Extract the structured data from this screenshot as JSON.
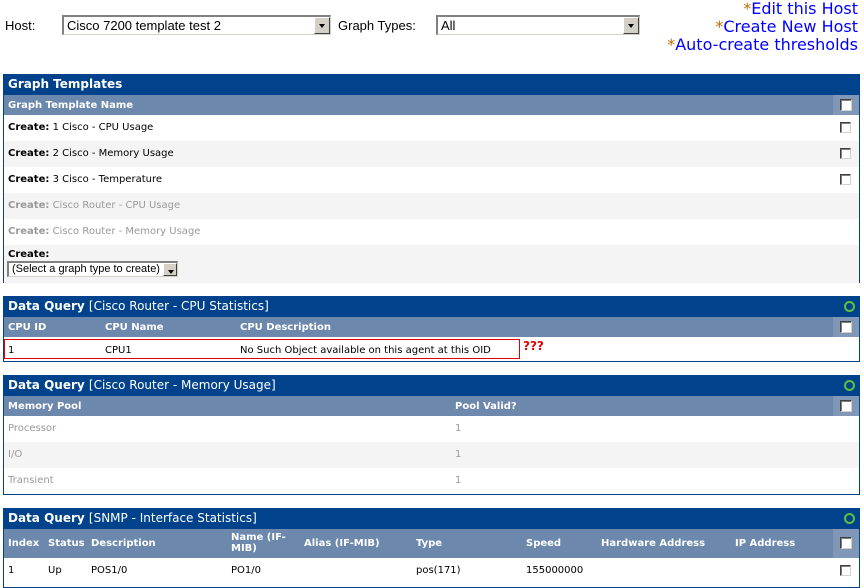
{
  "filters": {
    "host_label": "Host:",
    "host_value": "Cisco 7200 template test 2",
    "graph_types_label": "Graph Types:",
    "graph_types_value": "All"
  },
  "links": [
    {
      "star": "*",
      "label": "Edit this Host"
    },
    {
      "star": "*",
      "label": "Create New Host"
    },
    {
      "star": "*",
      "label": "Auto-create thresholds"
    }
  ],
  "graph_templates": {
    "title": "Graph Templates",
    "column_header": "Graph Template Name",
    "rows": [
      {
        "prefix": "Create:",
        "name": "1 Cisco - CPU Usage",
        "enabled": true
      },
      {
        "prefix": "Create:",
        "name": "2 Cisco - Memory Usage",
        "enabled": true
      },
      {
        "prefix": "Create:",
        "name": "3 Cisco - Temperature",
        "enabled": true
      },
      {
        "prefix": "Create:",
        "name": "Cisco Router - CPU Usage",
        "enabled": false
      },
      {
        "prefix": "Create:",
        "name": "Cisco Router - Memory Usage",
        "enabled": false
      }
    ],
    "create_label": "Create:",
    "create_select_value": "(Select a graph type to create)"
  },
  "dq_cpu": {
    "title": "Data Query",
    "subtitle": "[Cisco Router - CPU Statistics]",
    "columns": [
      "CPU ID",
      "CPU Name",
      "CPU Description"
    ],
    "rows": [
      {
        "cpu_id": "1",
        "cpu_name": "CPU1",
        "cpu_description": "No Such Object available on this agent at this OID"
      }
    ],
    "annotation": "???",
    "annotation_color": "#e00000"
  },
  "dq_memory": {
    "title": "Data Query",
    "subtitle": "[Cisco Router - Memory Usage]",
    "columns": [
      "Memory Pool",
      "Pool Valid?"
    ],
    "rows": [
      {
        "pool": "Processor",
        "valid": "1"
      },
      {
        "pool": "I/O",
        "valid": "1"
      },
      {
        "pool": "Transient",
        "valid": "1"
      }
    ]
  },
  "dq_interface": {
    "title": "Data Query",
    "subtitle": "[SNMP - Interface Statistics]",
    "columns": [
      "Index",
      "Status",
      "Description",
      "Name (IF-MIB)",
      "Alias (IF-MIB)",
      "Type",
      "Speed",
      "Hardware Address",
      "IP Address"
    ],
    "rows": [
      {
        "index": "1",
        "status": "Up",
        "description": "POS1/0",
        "name": "PO1/0",
        "alias": "",
        "type": "pos(171)",
        "speed": "155000000",
        "hw": "",
        "ip": ""
      }
    ]
  },
  "colors": {
    "panel_header": "#00438c",
    "column_header": "#6d88ad",
    "link": "#0000ff",
    "link_star": "#c46a00",
    "status_ring": "#5fbf3c"
  }
}
